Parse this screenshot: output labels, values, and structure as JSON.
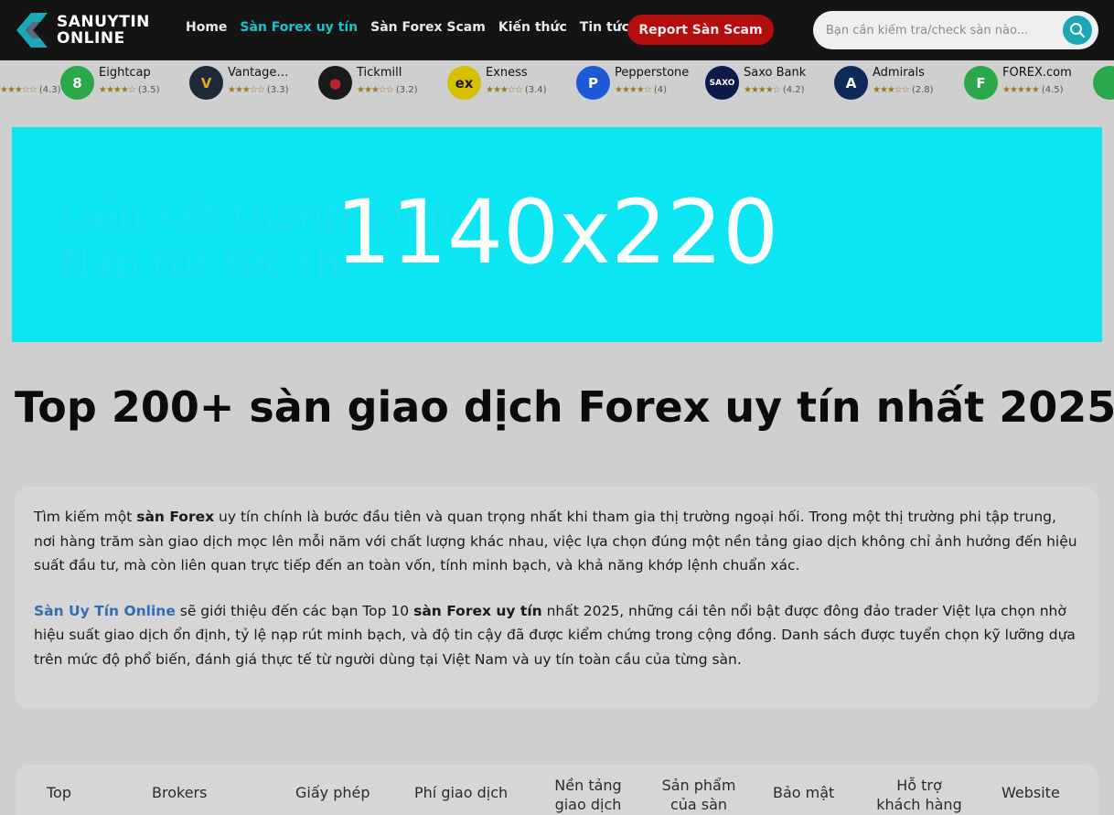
{
  "header": {
    "logo": {
      "line1": "SANUYTIN",
      "line2": "ONLINE"
    },
    "nav": [
      {
        "label": "Home",
        "active": false
      },
      {
        "label": "Sàn Forex uy tín",
        "active": true
      },
      {
        "label": "Sàn Forex Scam",
        "active": false
      },
      {
        "label": "Kiến thức",
        "active": false
      },
      {
        "label": "Tin tức",
        "active": false
      }
    ],
    "report_button": "Report Sàn Scam",
    "search": {
      "placeholder": "Bạn cần kiếm tra/check sàn nào...",
      "icon": "search-icon"
    }
  },
  "brokers": [
    {
      "name": "",
      "rating": "(4.3)",
      "stars": "★★★☆☆"
    },
    {
      "name": "Eightcap",
      "rating": "(3.5)",
      "stars": "★★★★☆",
      "logo_text": "8",
      "color": "#2aa84a"
    },
    {
      "name": "Vantage…",
      "rating": "(3.3)",
      "stars": "★★★☆☆",
      "logo_text": "V",
      "color": "#1e2a3a"
    },
    {
      "name": "Tickmill",
      "rating": "(3.2)",
      "stars": "★★★☆☆",
      "logo_text": "●",
      "color": "#1a1a1a"
    },
    {
      "name": "Exness",
      "rating": "(3.4)",
      "stars": "★★★☆☆",
      "logo_text": "ex",
      "color": "#e2c400"
    },
    {
      "name": "Pepperstone",
      "rating": "(4)",
      "stars": "★★★★☆",
      "logo_text": "P",
      "color": "#1e5ad8"
    },
    {
      "name": "Saxo Bank",
      "rating": "(4.2)",
      "stars": "★★★★☆",
      "logo_text": "SAXO",
      "color": "#0c1a4a"
    },
    {
      "name": "Admirals",
      "rating": "(2.8)",
      "stars": "★★★☆☆",
      "logo_text": "A",
      "color": "#0e2a5a"
    },
    {
      "name": "FOREX.com",
      "rating": "(4.5)",
      "stars": "★★★★★",
      "logo_text": "F",
      "color": "#2aa84a"
    }
  ],
  "banner": {
    "label": "1140x220",
    "ghost_line1": "Liên kết thanh toán",
    "ghost_line2": "Nạp rút tức thì"
  },
  "title": "Top 200+ sàn giao dịch Forex uy tín nhất 2025",
  "intro": {
    "p1_a": "Tìm kiếm một ",
    "p1_b": "sàn Forex",
    "p1_c": " uy tín chính là bước đầu tiên và quan trọng nhất khi tham gia thị trường ngoại hối. Trong một thị trường phi tập trung, nơi hàng trăm sàn giao dịch mọc lên mỗi năm với chất lượng khác nhau, việc lựa chọn đúng một nền tảng giao dịch không chỉ ảnh hưởng đến hiệu suất đầu tư, mà còn liên quan trực tiếp đến an toàn vốn, tính minh bạch, và khả năng khớp lệnh chuẩn xác.",
    "p2_link": "Sàn Uy Tín Online",
    "p2_a": " sẽ giới thiệu đến các bạn Top 10 ",
    "p2_b": "sàn Forex uy tín",
    "p2_c": " nhất 2025, những cái tên nổi bật được đông đảo trader Việt lựa chọn nhờ hiệu suất giao dịch ổn định, tỷ lệ nạp rút minh bạch, và độ tin cậy đã được kiểm chứng trong cộng đồng. Danh sách được tuyển chọn kỹ lưỡng dựa trên mức độ phổ biến, đánh giá thực tế từ người dùng tại Việt Nam và uy tín toàn cầu của từng sàn."
  },
  "table": {
    "headers": [
      "Top",
      "Brokers",
      "Giấy phép",
      "Phí giao dịch",
      "Nền tảng giao dịch",
      "Sản phẩm của sàn",
      "Bảo mật",
      "Hỗ trợ khách hàng",
      "Website"
    ]
  },
  "colors": {
    "accent": "#17c3cf",
    "report": "#b30d0d",
    "banner": "#0ce6f2"
  }
}
